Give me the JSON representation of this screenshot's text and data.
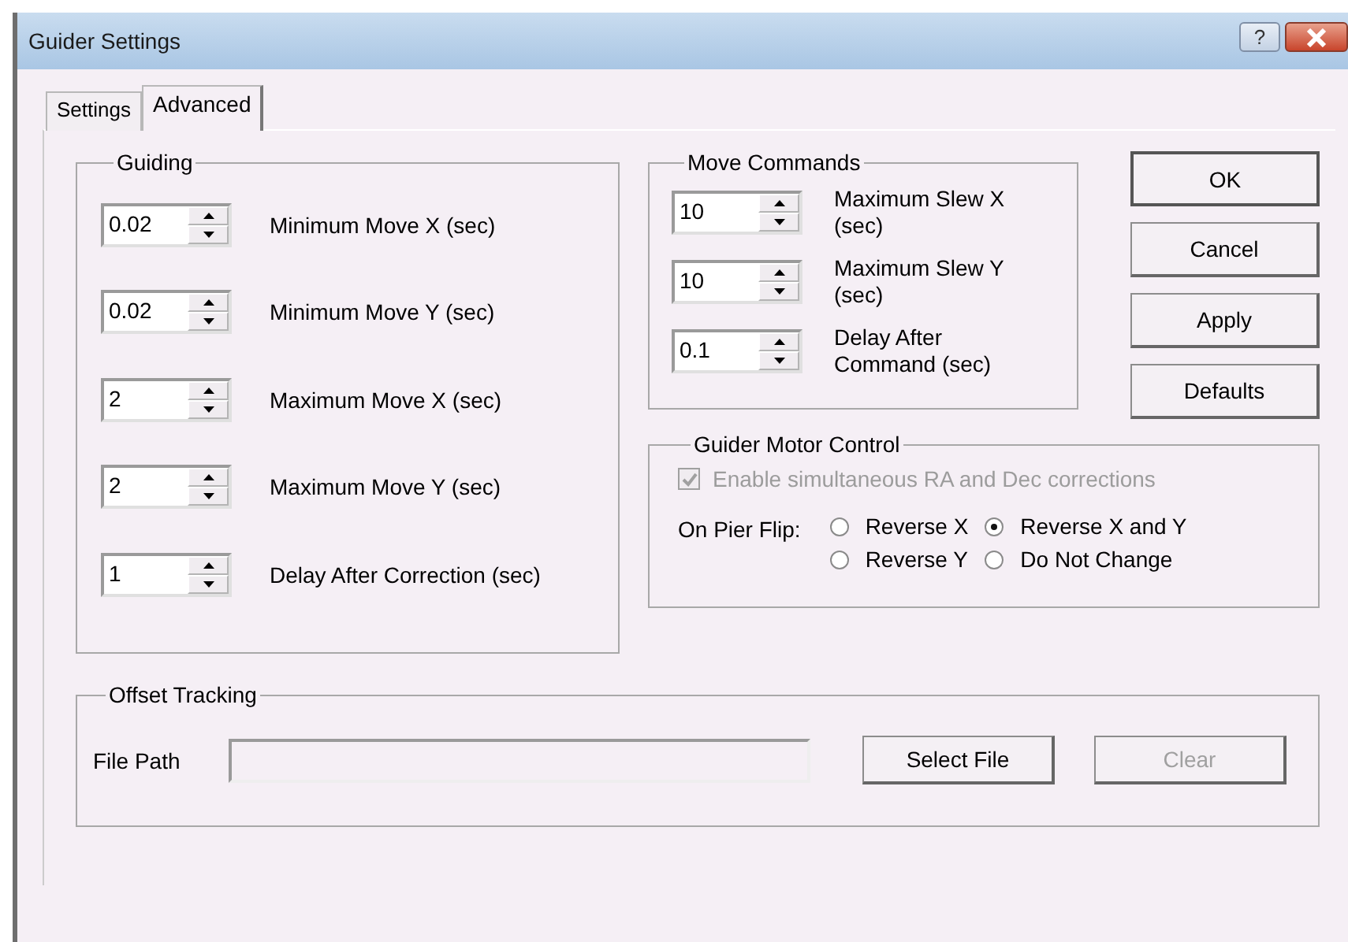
{
  "window": {
    "title": "Guider Settings",
    "help": "?"
  },
  "tabs": [
    {
      "label": "Settings",
      "selected": false
    },
    {
      "label": "Advanced",
      "selected": true
    }
  ],
  "guiding": {
    "title": "Guiding",
    "fields": [
      {
        "value": "0.02",
        "label": "Minimum Move X (sec)"
      },
      {
        "value": "0.02",
        "label": "Minimum Move Y (sec)"
      },
      {
        "value": "2",
        "label": "Maximum Move X (sec)"
      },
      {
        "value": "2",
        "label": "Maximum Move Y (sec)"
      },
      {
        "value": "1",
        "label": "Delay After Correction (sec)"
      }
    ]
  },
  "move_commands": {
    "title": "Move Commands",
    "fields": [
      {
        "value": "10",
        "label": "Maximum Slew X (sec)"
      },
      {
        "value": "10",
        "label": "Maximum Slew Y (sec)"
      },
      {
        "value": "0.1",
        "label": "Delay After Command (sec)"
      }
    ]
  },
  "buttons": [
    {
      "label": "OK",
      "default": true
    },
    {
      "label": "Cancel",
      "default": false
    },
    {
      "label": "Apply",
      "default": false
    },
    {
      "label": "Defaults",
      "default": false
    }
  ],
  "motor_control": {
    "title": "Guider Motor Control",
    "checkbox": {
      "label": "Enable simultaneous RA and Dec corrections",
      "checked": true,
      "disabled": true
    },
    "pier_flip_label": "On Pier Flip:",
    "options": [
      {
        "label": "Reverse X",
        "selected": false
      },
      {
        "label": "Reverse X and Y",
        "selected": true
      },
      {
        "label": "Reverse Y",
        "selected": false
      },
      {
        "label": "Do Not Change",
        "selected": false
      }
    ]
  },
  "offset_tracking": {
    "title": "Offset Tracking",
    "file_path_label": "File Path",
    "buttons": [
      {
        "label": "Select File",
        "disabled": false
      },
      {
        "label": "Clear",
        "disabled": true
      }
    ]
  }
}
